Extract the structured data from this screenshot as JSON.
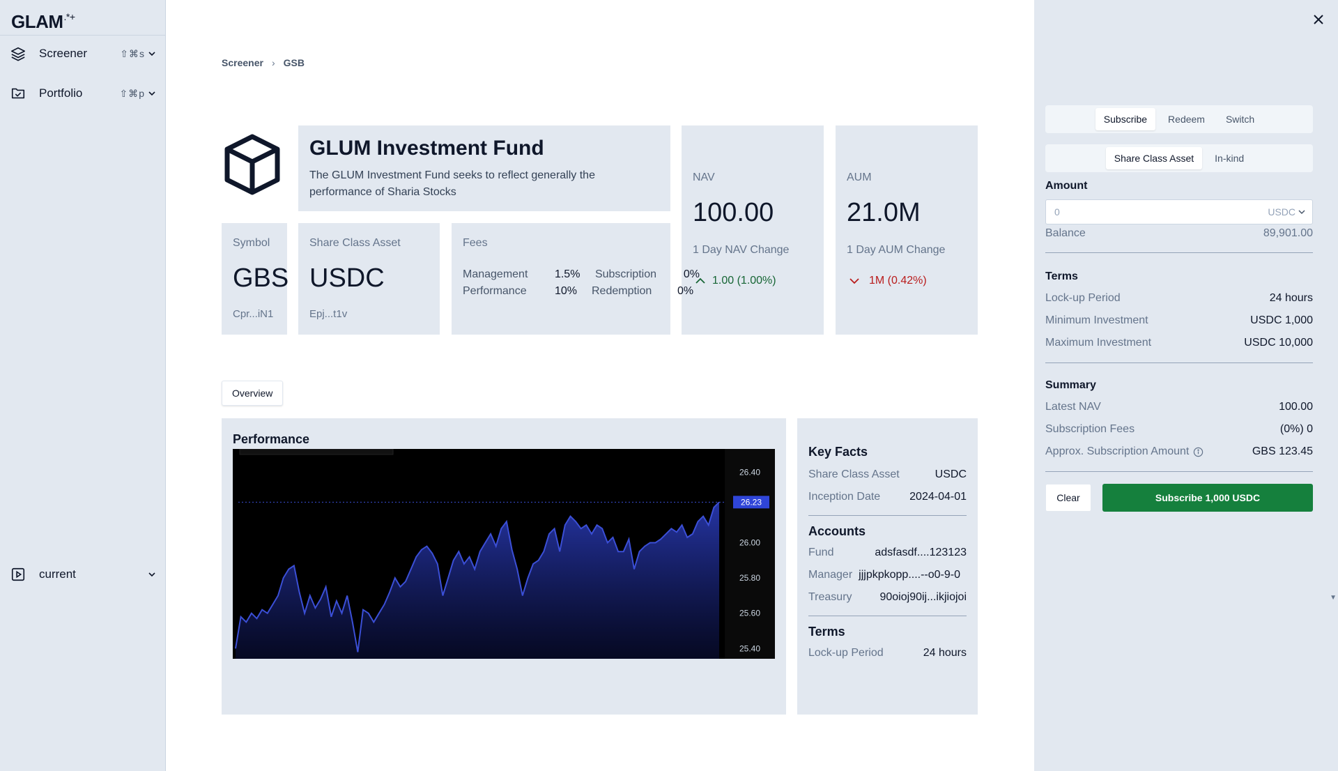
{
  "sidebar": {
    "logo": "GLAM",
    "logo_suffix": ".*+",
    "items": [
      {
        "label": "Screener",
        "shortcut": "⇧⌘s",
        "icon": "layers-icon"
      },
      {
        "label": "Portfolio",
        "shortcut": "⇧⌘p",
        "icon": "folder-check-icon"
      }
    ],
    "bottom": {
      "label": "current",
      "icon": "play-square-icon"
    }
  },
  "breadcrumb": {
    "root": "Screener",
    "current": "GSB"
  },
  "fund": {
    "icon": "cube-icon",
    "title": "GLUM Investment Fund",
    "description": "The GLUM Investment Fund seeks to reflect generally the performance of Sharia Stocks"
  },
  "nav": {
    "label": "NAV",
    "value": "100.00",
    "change_label": "1 Day NAV Change",
    "change": "1.00 (1.00%)",
    "direction": "up"
  },
  "aum": {
    "label": "AUM",
    "value": "21.0M",
    "change_label": "1 Day AUM Change",
    "change": "1M (0.42%)",
    "direction": "down"
  },
  "symbol": {
    "label": "Symbol",
    "value": "GBS",
    "address": "Cpr...iN1"
  },
  "share_class_asset": {
    "label": "Share Class Asset",
    "value": "USDC",
    "address": "Epj...t1v"
  },
  "fees": {
    "label": "Fees",
    "management_label": "Management",
    "management": "1.5%",
    "subscription_label": "Subscription",
    "subscription": "0%",
    "performance_label": "Performance",
    "performance": "10%",
    "redemption_label": "Redemption",
    "redemption": "0%"
  },
  "tabs": {
    "overview": "Overview"
  },
  "performance": {
    "title": "Performance"
  },
  "chart_data": {
    "type": "area",
    "title": "",
    "xlabel": "",
    "ylabel": "",
    "ylim": [
      25.35,
      26.5
    ],
    "yticks": [
      "26.40",
      "26.00",
      "25.80",
      "25.60",
      "25.40"
    ],
    "ytick_values": [
      26.4,
      26.0,
      25.8,
      25.6,
      25.4
    ],
    "last_value_label": "26.23",
    "last_value": 26.23,
    "series_color": "#3b4fd6",
    "series": [
      {
        "name": "",
        "values": [
          25.4,
          25.58,
          25.55,
          25.6,
          25.57,
          25.62,
          25.6,
          25.65,
          25.7,
          25.8,
          25.85,
          25.87,
          25.72,
          25.6,
          25.7,
          25.63,
          25.68,
          25.75,
          25.58,
          25.67,
          25.6,
          25.7,
          25.55,
          25.38,
          25.62,
          25.6,
          25.55,
          25.6,
          25.65,
          25.72,
          25.8,
          25.75,
          25.78,
          25.85,
          25.92,
          25.96,
          25.98,
          25.94,
          25.88,
          25.7,
          25.8,
          25.9,
          25.95,
          25.88,
          25.92,
          25.85,
          25.95,
          26.0,
          26.05,
          25.98,
          26.08,
          26.12,
          25.96,
          25.85,
          25.7,
          25.8,
          25.88,
          25.9,
          25.95,
          26.05,
          26.08,
          25.95,
          26.1,
          26.15,
          26.12,
          26.08,
          26.1,
          26.05,
          26.1,
          26.08,
          26.0,
          26.03,
          25.95,
          25.95,
          26.02,
          25.85,
          25.95,
          25.98,
          26.0,
          26.0,
          26.02,
          26.05,
          26.08,
          26.06,
          26.1,
          26.03,
          26.05,
          26.12,
          26.15,
          26.1,
          26.2,
          26.23
        ]
      }
    ]
  },
  "key_facts": {
    "title": "Key Facts",
    "rows": [
      {
        "k": "Share Class Asset",
        "v": "USDC"
      },
      {
        "k": "Inception Date",
        "v": "2024-04-01"
      }
    ],
    "accounts_title": "Accounts",
    "accounts": [
      {
        "k": "Fund",
        "v": "adsfasdf....123123"
      },
      {
        "k": "Manager",
        "v": "jjjpkpkopp....--o0-9-0"
      },
      {
        "k": "Treasury",
        "v": "90oioj90ij...ikjiojoi"
      }
    ],
    "terms_title": "Terms",
    "terms": [
      {
        "k": "Lock-up Period",
        "v": "24 hours"
      }
    ]
  },
  "panel": {
    "mode_tabs": [
      "Subscribe",
      "Redeem",
      "Switch"
    ],
    "active_mode": "Subscribe",
    "asset_tabs": [
      "Share Class Asset",
      "In-kind"
    ],
    "active_asset": "Share Class Asset",
    "amount_label": "Amount",
    "amount_placeholder": "0",
    "currency": "USDC",
    "balance_label": "Balance",
    "balance": "89,901.00",
    "terms_title": "Terms",
    "terms": [
      {
        "k": "Lock-up Period",
        "v": "24 hours"
      },
      {
        "k": "Minimum Investment",
        "v": "USDC 1,000"
      },
      {
        "k": "Maximum Investment",
        "v": "USDC 10,000"
      }
    ],
    "summary_title": "Summary",
    "summary": [
      {
        "k": "Latest NAV",
        "v": "100.00"
      },
      {
        "k": "Subscription Fees",
        "v": "(0%) 0"
      },
      {
        "k": "Approx. Subscription Amount",
        "v": "GBS 123.45"
      }
    ],
    "clear_label": "Clear",
    "submit_label": "Subscribe 1,000 USDC"
  },
  "colors": {
    "accent_green": "#15803d",
    "up": "#166534",
    "down": "#b91c1c",
    "card_bg": "#e2e8f0"
  }
}
